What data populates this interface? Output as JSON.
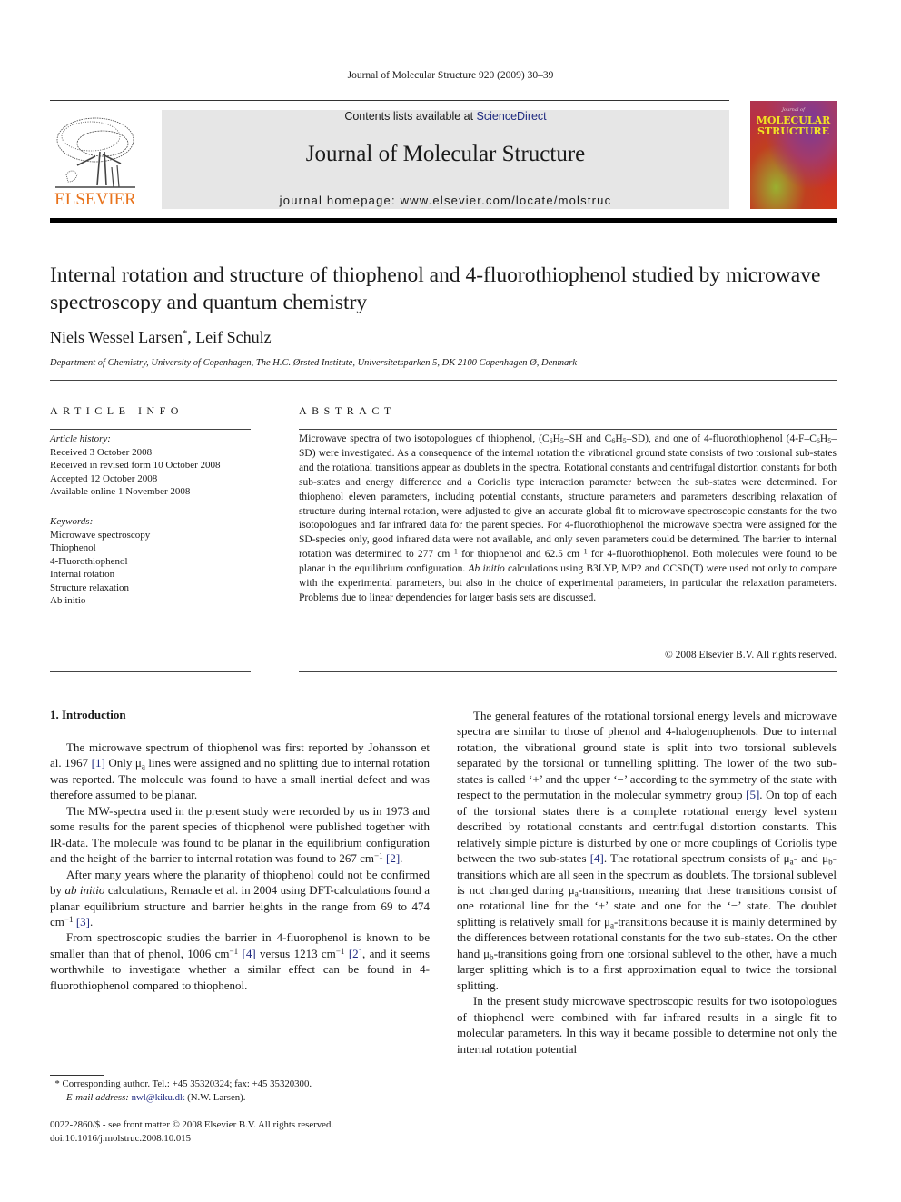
{
  "running_head": "Journal of Molecular Structure 920 (2009) 30–39",
  "masthead": {
    "publisher_logo_text": "ELSEVIER",
    "contents_prefix": "Contents lists available at ",
    "contents_link": "ScienceDirect",
    "journal_title": "Journal of Molecular Structure",
    "homepage": "journal homepage: www.elsevier.com/locate/molstruc",
    "cover_small_text": "Journal of",
    "cover_title_line1": "MOLECULAR",
    "cover_title_line2": "STRUCTURE"
  },
  "article": {
    "title": "Internal rotation and structure of thiophenol and 4-fluorothiophenol studied by microwave spectroscopy and quantum chemistry",
    "authors": "Niels Wessel Larsen",
    "author_mark": "*",
    "authors_rest": ", Leif Schulz",
    "affiliation": "Department of Chemistry, University of Copenhagen, The H.C. Ørsted Institute, Universitetsparken 5, DK 2100 Copenhagen Ø, Denmark"
  },
  "article_info": {
    "heading": "ARTICLE INFO",
    "history_label": "Article history:",
    "history": [
      "Received 3 October 2008",
      "Received in revised form 10 October 2008",
      "Accepted 12 October 2008",
      "Available online 1 November 2008"
    ],
    "keywords_label": "Keywords:",
    "keywords": [
      "Microwave spectroscopy",
      "Thiophenol",
      "4-Fluorothiophenol",
      "Internal rotation",
      "Structure relaxation",
      "Ab initio"
    ]
  },
  "abstract": {
    "heading": "ABSTRACT",
    "p1": "Microwave spectra of two isotopologues of thiophenol, (C",
    "p1_sub1": "6",
    "p1_b": "H",
    "p1_sub2": "5",
    "p1_c": "–SH and C",
    "p1_sub3": "6",
    "p1_d": "H",
    "p1_sub4": "5",
    "p1_e": "–SD), and one of 4-fluorothiophenol (4-F–C",
    "p1_sub5": "6",
    "p1_f": "H",
    "p1_sub6": "5",
    "p1_g": "–SD) were investigated. As a consequence of the internal rotation the vibrational ground state consists of two torsional sub-states and the rotational transitions appear as doublets in the spectra. Rotational constants and centrifugal distortion constants for both sub-states and energy difference and a Coriolis type interaction parameter between the sub-states were determined. For thiophenol eleven parameters, including potential constants, structure parameters and parameters describing relaxation of structure during internal rotation, were adjusted to give an accurate global fit to microwave spectroscopic constants for the two isotopologues and far infrared data for the parent species. For 4-fluorothiophenol the microwave spectra were assigned for the SD-species only, good infrared data were not available, and only seven parameters could be determined. The barrier to internal rotation was determined to 277 cm",
    "p1_sup1": "−1",
    "p1_h": " for thiophenol and 62.5 cm",
    "p1_sup2": "−1",
    "p1_i": " for 4-fluorothiophenol. Both molecules were found to be planar in the equilibrium configuration. ",
    "p1_italic": "Ab initio",
    "p1_j": " calculations using B3LYP, MP2 and CCSD(T) were used not only to compare with the experimental parameters, but also in the choice of experimental parameters, in particular the relaxation parameters. Problems due to linear dependencies for larger basis sets are discussed.",
    "copyright": "© 2008 Elsevier B.V. All rights reserved."
  },
  "body": {
    "section_heading": "1. Introduction",
    "left": {
      "p1_a": "The microwave spectrum of thiophenol was first reported by Johansson et al. 1967 ",
      "p1_ref": "[1]",
      "p1_b": " Only μ",
      "p1_sub": "a",
      "p1_c": " lines were assigned and no splitting due to internal rotation was reported. The molecule was found to have a small inertial defect and was therefore assumed to be planar.",
      "p2_a": "The MW-spectra used in the present study were recorded by us in 1973 and some results for the parent species of thiophenol were published together with IR-data. The molecule was found to be planar in the equilibrium configuration and the height of the barrier to internal rotation was found to 267 cm",
      "p2_sup": "−1",
      "p2_ref": "[2]",
      "p2_b": ".",
      "p3_a": "After many years where the planarity of thiophenol could not be confirmed by ",
      "p3_italic": "ab initio",
      "p3_b": " calculations, Remacle et al. in 2004 using DFT-calculations found a planar equilibrium structure and barrier heights in the range from 69 to 474 cm",
      "p3_sup": "−1",
      "p3_ref": "[3]",
      "p3_c": ".",
      "p4_a": "From spectroscopic studies the barrier in 4-fluorophenol is known to be smaller than that of phenol, 1006 cm",
      "p4_sup1": "−1",
      "p4_ref1": "[4]",
      "p4_b": " versus 1213 cm",
      "p4_sup2": "−1",
      "p4_ref2": "[2]",
      "p4_c": ", and it seems worthwhile to investigate whether a similar effect can be found in 4-fluorothiophenol compared to thiophenol."
    },
    "right": {
      "p1_a": "The general features of the rotational torsional energy levels and microwave spectra are similar to those of phenol and 4-halogenophenols. Due to internal rotation, the vibrational ground state is split into two torsional sublevels separated by the torsional or tunnelling splitting. The lower of the two sub-states is called ‘+’ and the upper ‘−’ according to the symmetry of the state with respect to the permutation in the molecular symmetry group ",
      "p1_ref1": "[5]",
      "p1_b": ". On top of each of the torsional states there is a complete rotational energy level system described by rotational constants and centrifugal distortion constants. This relatively simple picture is disturbed by one or more couplings of Coriolis type between the two sub-states ",
      "p1_ref2": "[4]",
      "p1_c": ". The rotational spectrum consists of μ",
      "p1_sub1": "a",
      "p1_d": "- and μ",
      "p1_sub2": "b",
      "p1_e": "-transitions which are all seen in the spectrum as doublets. The torsional sublevel is not changed during μ",
      "p1_sub3": "a",
      "p1_f": "-transitions, meaning that these transitions consist of one rotational line for the ‘+’ state and one for the ‘−’ state. The doublet splitting is relatively small for μ",
      "p1_sub4": "a",
      "p1_g": "-transitions because it is mainly determined by the differences between rotational constants for the two sub-states. On the other hand μ",
      "p1_sub5": "b",
      "p1_h": "-transitions going from one torsional sublevel to the other, have a much larger splitting which is to a first approximation equal to twice the torsional splitting.",
      "p2": "In the present study microwave spectroscopic results for two isotopologues of thiophenol were combined with far infrared results in a single fit to molecular parameters. In this way it became possible to determine not only the internal rotation potential"
    }
  },
  "footnotes": {
    "mark": "*",
    "corresponding": " Corresponding author. Tel.: +45 35320324; fax: +45 35320300.",
    "email_label": "E-mail address:",
    "email": "nwl@kiku.dk",
    "email_suffix": " (N.W. Larsen).",
    "issn_line": "0022-2860/$ - see front matter © 2008 Elsevier B.V. All rights reserved.",
    "doi": "doi:10.1016/j.molstruc.2008.10.015"
  },
  "colors": {
    "link": "#1f2a80",
    "elsevier_orange": "#e8731c",
    "masthead_gray": "#e6e6e6",
    "cover_title_yellow": "#f2e424"
  }
}
